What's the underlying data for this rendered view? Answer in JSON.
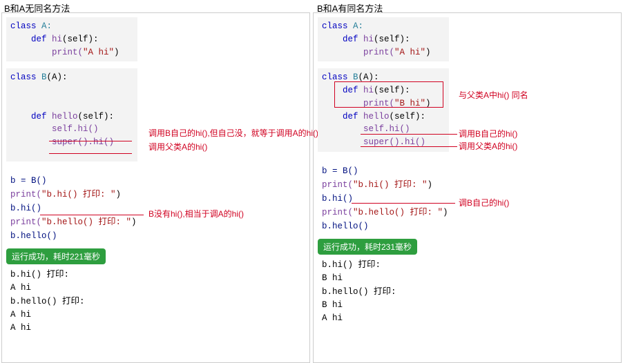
{
  "left": {
    "title": "B和A无同名方法",
    "classA_kw": "class",
    "classA_name": " A:",
    "defA_kw": "    def",
    "defA_name": " hi",
    "defA_params": "(self):",
    "printA": "        print(",
    "strA": "\"A hi\"",
    "printA_end": ")",
    "classB_kw": "class",
    "classB_name": " B",
    "classB_paren": "(A):",
    "defHello_kw": "    def",
    "defHello_name": " hello",
    "defHello_params": "(self):",
    "selfhi": "        self.hi()",
    "superhi": "        super().hi()",
    "run1": "b = B()",
    "run2a": "print(",
    "run2b": "\"b.hi() 打印: \"",
    "run2c": ")",
    "run3": "b.hi()",
    "run4a": "print(",
    "run4b": "\"b.hello() 打印: \"",
    "run4c": ")",
    "run5": "b.hello()",
    "badge": "运行成功，耗时221毫秒",
    "out": "b.hi() 打印:\nA hi\nb.hello() 打印:\nA hi\nA hi",
    "ann1": "调用B自己的hi(),但自己没，就等于调用A的hi()",
    "ann2": "调用父类A的hi()",
    "ann3": "B没有hi(),相当于调A的hi()"
  },
  "right": {
    "title": "B和A有同名方法",
    "classA_kw": "class",
    "classA_name": " A:",
    "defA_kw": "    def",
    "defA_name": " hi",
    "defA_params": "(self):",
    "printA": "        print(",
    "strA": "\"A hi\"",
    "printA_end": ")",
    "classB_kw": "class",
    "classB_name": " B",
    "classB_paren": "(A):",
    "defBhi_kw": "    def",
    "defBhi_name": " hi",
    "defBhi_params": "(self):",
    "printB": "        print(",
    "strB": "\"B hi\"",
    "printB_end": ")",
    "defHello_kw": "    def",
    "defHello_name": " hello",
    "defHello_params": "(self):",
    "selfhi": "        self.hi()",
    "superhi": "        super().hi()",
    "run1": "b = B()",
    "run2a": "print(",
    "run2b": "\"b.hi() 打印: \"",
    "run2c": ")",
    "run3": "b.hi()",
    "run4a": "print(",
    "run4b": "\"b.hello() 打印: \"",
    "run4c": ")",
    "run5": "b.hello()",
    "badge": "运行成功，耗时231毫秒",
    "out": "b.hi() 打印:\nB hi\nb.hello() 打印:\nB hi\nA hi",
    "ann_box": "与父类A中hi() 同名",
    "ann1": "调用B自己的hi()",
    "ann2": "调用父类A的hi()",
    "ann3": "调B自己的hi()"
  }
}
